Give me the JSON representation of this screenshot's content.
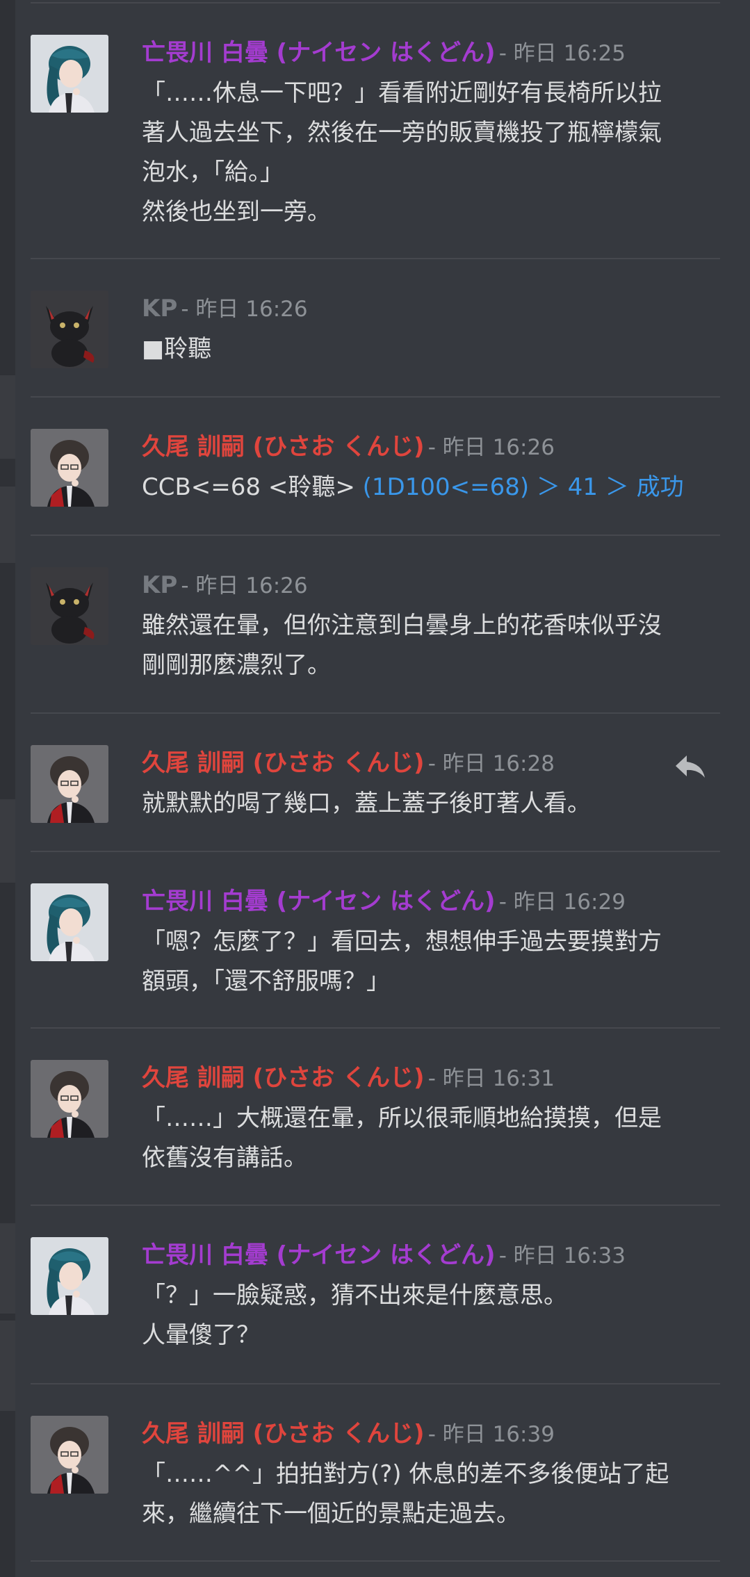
{
  "messages": [
    {
      "type": "naisen",
      "name": "亡畏川 白曇 (ナイセン はくどん)",
      "timestamp": "- 昨日 16:25",
      "lines": [
        "「……休息一下吧？」看看附近剛好有長椅所以拉",
        "著人過去坐下，然後在一旁的販賣機投了瓶檸檬氣",
        "泡水，「給。」",
        "然後也坐到一旁。"
      ]
    },
    {
      "type": "kp",
      "name": "KP",
      "timestamp": "- 昨日 16:26",
      "lines": [
        "■聆聽"
      ]
    },
    {
      "type": "kuo",
      "name": "久尾 訓嗣 (ひさお くんじ)",
      "timestamp": "- 昨日 16:26",
      "command": "CCB<=68 <聆聽> ",
      "dice_result": "(1D100<=68) ＞ 41 ＞ 成功"
    },
    {
      "type": "kp",
      "name": "KP",
      "timestamp": "- 昨日 16:26",
      "lines": [
        "雖然還在暈，但你注意到白曇身上的花香味似乎沒",
        "剛剛那麼濃烈了。"
      ]
    },
    {
      "type": "kuo",
      "name": "久尾 訓嗣 (ひさお くんじ)",
      "timestamp": "- 昨日 16:28",
      "lines": [
        "就默默的喝了幾口，蓋上蓋子後盯著人看。"
      ]
    },
    {
      "type": "naisen",
      "name": "亡畏川 白曇 (ナイセン はくどん)",
      "timestamp": "- 昨日 16:29",
      "lines": [
        "「嗯？怎麼了？」看回去，想想伸手過去要摸對方",
        "額頭，「還不舒服嗎？」"
      ]
    },
    {
      "type": "kuo",
      "name": "久尾 訓嗣 (ひさお くんじ)",
      "timestamp": "- 昨日 16:31",
      "lines": [
        "「……」大概還在暈，所以很乖順地給摸摸，但是",
        "依舊沒有講話。"
      ]
    },
    {
      "type": "naisen",
      "name": "亡畏川 白曇 (ナイセン はくどん)",
      "timestamp": "- 昨日 16:33",
      "lines": [
        "「？」一臉疑惑，猜不出來是什麼意思。",
        "人暈傻了？"
      ]
    },
    {
      "type": "kuo",
      "name": "久尾 訓嗣 (ひさお くんじ)",
      "timestamp": "- 昨日 16:39",
      "lines": [
        "「……^^」拍拍對方(?) 休息的差不多後便站了起",
        "來，繼續往下一個近的景點走過去。"
      ]
    }
  ],
  "colors": {
    "background": "#36393f",
    "naisen_name": "#a43cd0",
    "kuo_name": "#e0453d",
    "kp_name": "#777b81",
    "timestamp": "#8e9297",
    "text": "#dcddde",
    "dice": "#3a97ea"
  },
  "icons": {
    "reply": "reply-arrow-icon"
  }
}
